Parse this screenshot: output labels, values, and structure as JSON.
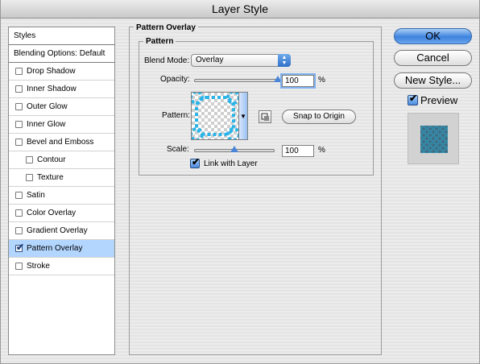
{
  "window": {
    "title": "Layer Style"
  },
  "sidebar": {
    "header": "Styles",
    "blending": "Blending Options: Default",
    "items": [
      {
        "label": "Drop Shadow",
        "checked": false
      },
      {
        "label": "Inner Shadow",
        "checked": false
      },
      {
        "label": "Outer Glow",
        "checked": false
      },
      {
        "label": "Inner Glow",
        "checked": false
      },
      {
        "label": "Bevel and Emboss",
        "checked": false
      },
      {
        "label": "Contour",
        "checked": false
      },
      {
        "label": "Texture",
        "checked": false
      },
      {
        "label": "Satin",
        "checked": false
      },
      {
        "label": "Color Overlay",
        "checked": false
      },
      {
        "label": "Gradient Overlay",
        "checked": false
      },
      {
        "label": "Pattern Overlay",
        "checked": true
      },
      {
        "label": "Stroke",
        "checked": false
      }
    ]
  },
  "panel": {
    "title": "Pattern Overlay",
    "group": "Pattern",
    "blend_mode_label": "Blend Mode:",
    "blend_mode_value": "Overlay",
    "opacity_label": "Opacity:",
    "opacity_value": "100",
    "opacity_unit": "%",
    "opacity_level": 1.0,
    "pattern_label": "Pattern:",
    "snap_label": "Snap to Origin",
    "scale_label": "Scale:",
    "scale_value": "100",
    "scale_unit": "%",
    "scale_level": 0.5,
    "link_label": "Link with Layer",
    "link_checked": true
  },
  "buttons": {
    "ok": "OK",
    "cancel": "Cancel",
    "new_style": "New Style..."
  },
  "preview": {
    "label": "Preview",
    "checked": true
  },
  "colors": {
    "accent": "#3d82de",
    "pattern": "#2ab4e8",
    "selection": "#b3d6ff"
  },
  "icons": {
    "blend_arrows": "up-down-arrows-icon",
    "pattern_menu": "triangle-down-icon",
    "new_preset": "new-preset-icon",
    "checkmark": "checkmark-icon"
  }
}
